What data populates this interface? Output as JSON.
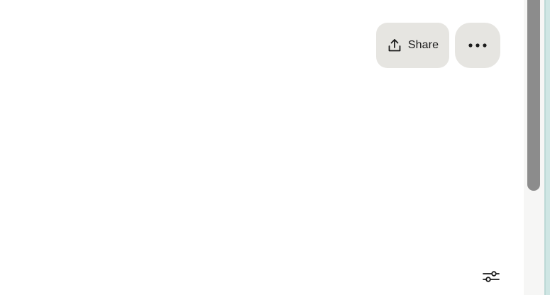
{
  "toolbar": {
    "share_label": "Share",
    "share_icon": "share-upload-icon",
    "more_icon": "more-horizontal-icon",
    "button_bg": "#e6e5e1"
  },
  "footer": {
    "settings_icon": "sliders-icon"
  },
  "scrollbar": {
    "thumb_color": "#8c8c8c"
  }
}
